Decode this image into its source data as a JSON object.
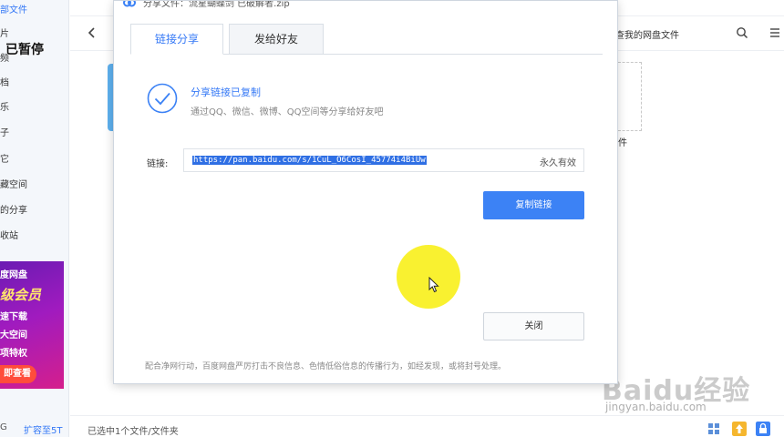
{
  "sidebar": {
    "items": [
      {
        "label": "部文件",
        "active": true
      },
      {
        "label": "片"
      },
      {
        "label": "频"
      },
      {
        "label": "档"
      },
      {
        "label": "乐"
      },
      {
        "label": "子"
      },
      {
        "label": "它"
      },
      {
        "label": "藏空间"
      },
      {
        "label": "的分享"
      },
      {
        "label": "收站"
      }
    ],
    "paused_overlay": "已暂停",
    "promo": {
      "line1": "度网盘",
      "line2": "级会员",
      "line3": "速下载",
      "line4": "大空间",
      "line5": "项特权",
      "cta": "即查看"
    },
    "storage_suffix": "G",
    "expand_label": "扩容至5T"
  },
  "navbar": {
    "path": "查我的网盘文件"
  },
  "file_card": {
    "label": "件"
  },
  "statusbar": {
    "text": "已选中1个文件/文件夹"
  },
  "dialog": {
    "title": "分享文件：流星蝴蝶剑 已破解者.zip",
    "tabs": [
      {
        "label": "链接分享",
        "active": true
      },
      {
        "label": "发给好友",
        "active": false
      }
    ],
    "success_title": "分享链接已复制",
    "success_desc": "通过QQ、微信、微博、QQ空间等分享给好友吧",
    "link_label": "链接:",
    "link_value": "https://pan.baidu.com/s/1CuL_O6CosI_45774i4BiUw",
    "link_validity": "永久有效",
    "copy_button": "复制链接",
    "close_button": "关闭",
    "notice": "配合净网行动，百度网盘严厉打击不良信息、色情低俗信息的传播行为，如经发现，或将封号处理。"
  },
  "watermark": {
    "brand": "Baidu经验",
    "url": "jingyan.baidu.com"
  },
  "colors": {
    "accent": "#3478f6",
    "button_primary": "#3c82f5",
    "cursor_highlight": "#f8f01e"
  }
}
